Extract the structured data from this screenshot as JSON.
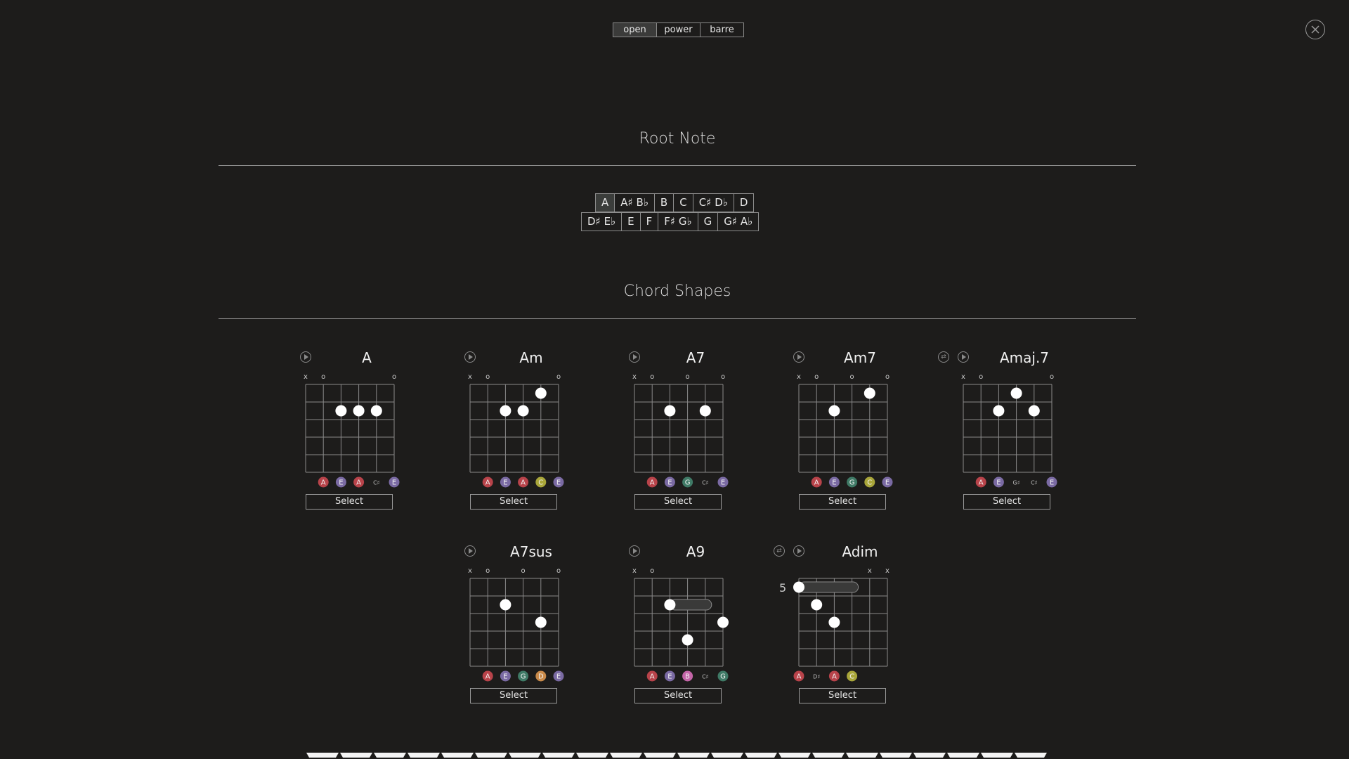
{
  "modes": {
    "items": [
      {
        "label": "open",
        "active": true
      },
      {
        "label": "power",
        "active": false
      },
      {
        "label": "barre",
        "active": false
      }
    ]
  },
  "close_icon": "close-circle-icon",
  "root_note": {
    "title": "Root Note",
    "row1": [
      {
        "label": "A",
        "active": true
      },
      {
        "label": "A♯ B♭",
        "active": false
      },
      {
        "label": "B",
        "active": false
      },
      {
        "label": "C",
        "active": false
      },
      {
        "label": "C♯ D♭",
        "active": false
      },
      {
        "label": "D",
        "active": false
      }
    ],
    "row2": [
      {
        "label": "D♯ E♭",
        "active": false
      },
      {
        "label": "E",
        "active": false
      },
      {
        "label": "F",
        "active": false
      },
      {
        "label": "F♯ G♭",
        "active": false
      },
      {
        "label": "G",
        "active": false
      },
      {
        "label": "G♯ A♭",
        "active": false
      }
    ]
  },
  "chord_shapes": {
    "title": "Chord Shapes",
    "select_label": "Select",
    "note_colors": {
      "A": "#b8434a",
      "E": "#7a6aa3",
      "G": "#3f7a66",
      "C": "#a9a63a",
      "D": "#c98a4a",
      "B": "#c465a8"
    },
    "chords": [
      {
        "name": "A",
        "has_swap": false,
        "start_fret": null,
        "markers": [
          "x",
          "o",
          "",
          "",
          "",
          "o"
        ],
        "dots": [
          {
            "string": 3,
            "fret": 2
          },
          {
            "string": 4,
            "fret": 2
          },
          {
            "string": 5,
            "fret": 2
          }
        ],
        "barre": null,
        "notes": [
          null,
          "A",
          "E",
          "A",
          "C♯",
          "E"
        ],
        "colored": [
          false,
          true,
          true,
          true,
          false,
          true
        ]
      },
      {
        "name": "Am",
        "has_swap": false,
        "start_fret": null,
        "markers": [
          "x",
          "o",
          "",
          "",
          "",
          "o"
        ],
        "dots": [
          {
            "string": 3,
            "fret": 2
          },
          {
            "string": 4,
            "fret": 2
          },
          {
            "string": 5,
            "fret": 1
          }
        ],
        "barre": null,
        "notes": [
          null,
          "A",
          "E",
          "A",
          "C",
          "E"
        ],
        "colored": [
          false,
          true,
          true,
          true,
          true,
          true
        ]
      },
      {
        "name": "A7",
        "has_swap": false,
        "start_fret": null,
        "markers": [
          "x",
          "o",
          "",
          "o",
          "",
          "o"
        ],
        "dots": [
          {
            "string": 3,
            "fret": 2
          },
          {
            "string": 5,
            "fret": 2
          }
        ],
        "barre": null,
        "notes": [
          null,
          "A",
          "E",
          "G",
          "C♯",
          "E"
        ],
        "colored": [
          false,
          true,
          true,
          true,
          false,
          true
        ]
      },
      {
        "name": "Am7",
        "has_swap": false,
        "start_fret": null,
        "markers": [
          "x",
          "o",
          "",
          "o",
          "",
          "o"
        ],
        "dots": [
          {
            "string": 3,
            "fret": 2
          },
          {
            "string": 5,
            "fret": 1
          }
        ],
        "barre": null,
        "notes": [
          null,
          "A",
          "E",
          "G",
          "C",
          "E"
        ],
        "colored": [
          false,
          true,
          true,
          true,
          true,
          true
        ]
      },
      {
        "name": "Amaj.7",
        "has_swap": true,
        "start_fret": null,
        "markers": [
          "x",
          "o",
          "",
          "",
          "",
          "o"
        ],
        "dots": [
          {
            "string": 3,
            "fret": 2
          },
          {
            "string": 4,
            "fret": 1
          },
          {
            "string": 5,
            "fret": 2
          }
        ],
        "barre": null,
        "notes": [
          null,
          "A",
          "E",
          "G♯",
          "C♯",
          "E"
        ],
        "colored": [
          false,
          true,
          true,
          false,
          false,
          true
        ]
      },
      {
        "name": "A7sus",
        "has_swap": false,
        "start_fret": null,
        "markers": [
          "x",
          "o",
          "",
          "o",
          "",
          "o"
        ],
        "dots": [
          {
            "string": 3,
            "fret": 2
          },
          {
            "string": 5,
            "fret": 3
          }
        ],
        "barre": null,
        "notes": [
          null,
          "A",
          "E",
          "G",
          "D",
          "E"
        ],
        "colored": [
          false,
          true,
          true,
          true,
          true,
          true
        ]
      },
      {
        "name": "A9",
        "has_swap": false,
        "start_fret": null,
        "markers": [
          "x",
          "o",
          "",
          "",
          "",
          ""
        ],
        "dots": [
          {
            "string": 3,
            "fret": 2
          },
          {
            "string": 4,
            "fret": 4
          },
          {
            "string": 6,
            "fret": 3
          }
        ],
        "barre": {
          "fret": 2,
          "from": 3,
          "to": 5
        },
        "notes": [
          null,
          "A",
          "E",
          "B",
          "C♯",
          "G"
        ],
        "colored": [
          false,
          true,
          true,
          true,
          false,
          true
        ]
      },
      {
        "name": "Adim",
        "has_swap": true,
        "start_fret": "5",
        "markers": [
          "",
          "",
          "",
          "",
          "x",
          "x"
        ],
        "dots": [
          {
            "string": 1,
            "fret": 1
          },
          {
            "string": 2,
            "fret": 2
          },
          {
            "string": 3,
            "fret": 3
          }
        ],
        "barre": {
          "fret": 1,
          "from": 1,
          "to": 4
        },
        "notes": [
          "A",
          "D♯",
          "A",
          "C",
          null,
          null
        ],
        "colored": [
          true,
          false,
          true,
          true,
          false,
          false
        ]
      }
    ]
  }
}
